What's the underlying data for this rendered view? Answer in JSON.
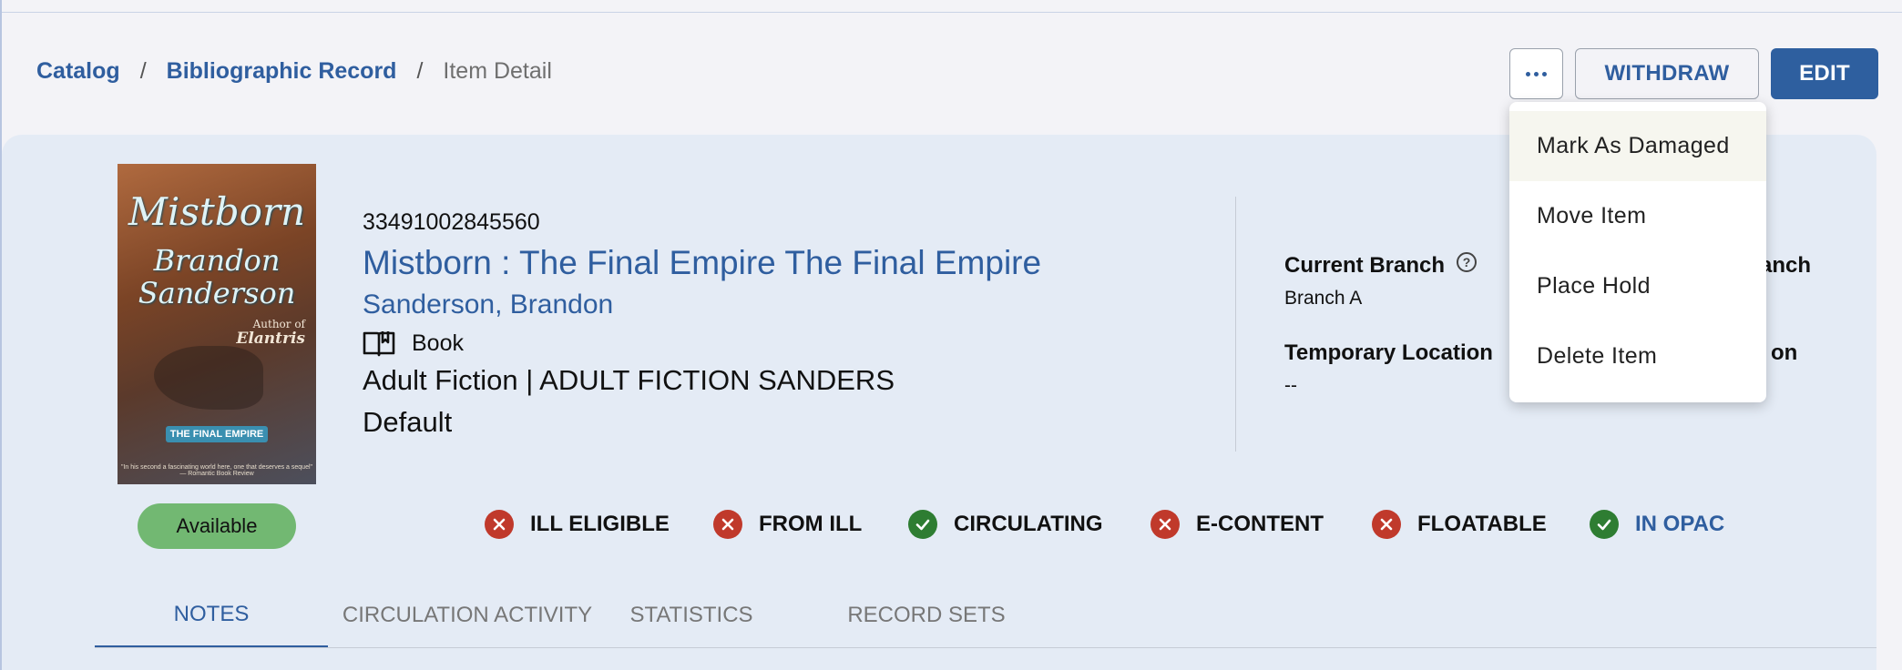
{
  "breadcrumb": {
    "items": [
      "Catalog",
      "Bibliographic Record"
    ],
    "separator": "/",
    "current": "Item Detail"
  },
  "header_actions": {
    "more_icon": "ellipsis-icon",
    "withdraw_label": "WITHDRAW",
    "edit_label": "EDIT"
  },
  "menu": {
    "items": [
      "Mark As Damaged",
      "Move Item",
      "Place Hold",
      "Delete Item"
    ],
    "highlighted": "Mark As Damaged"
  },
  "cover": {
    "title": "Mistborn",
    "author_line1": "Brandon",
    "author_line2": "Sanderson",
    "note_small": "Author of",
    "note_book": "Elantris",
    "badge": "THE FINAL EMPIRE",
    "quote": "\"In his second a fascinating world here, one that deserves a sequel\" — Romantic Book Review"
  },
  "item": {
    "barcode": "33491002845560",
    "title": "Mistborn : The Final Empire The Final Empire",
    "author": "Sanderson, Brandon",
    "format": "Book",
    "format_icon": "book-open-icon",
    "collection": "Adult Fiction | ADULT FICTION SANDERS",
    "default": "Default",
    "status": "Available"
  },
  "fields": {
    "current_branch_label": "Current Branch",
    "current_branch_value": "Branch A",
    "home_branch_label_partial": "anch",
    "temp_location_label": "Temporary Location",
    "temp_location_value": "--",
    "location_label_partial": "on"
  },
  "flags": [
    {
      "label": "ILL ELIGIBLE",
      "state": "no"
    },
    {
      "label": "FROM ILL",
      "state": "no"
    },
    {
      "label": "CIRCULATING",
      "state": "yes"
    },
    {
      "label": "E-CONTENT",
      "state": "no"
    },
    {
      "label": "FLOATABLE",
      "state": "no"
    },
    {
      "label": "IN OPAC",
      "state": "yes"
    }
  ],
  "tabs": [
    "NOTES",
    "CIRCULATION ACTIVITY",
    "STATISTICS",
    "RECORD SETS"
  ],
  "active_tab": "NOTES",
  "colors": {
    "accent": "#2f5e9f",
    "available": "#72b872",
    "no": "#c0392b",
    "yes": "#2e7d32"
  }
}
